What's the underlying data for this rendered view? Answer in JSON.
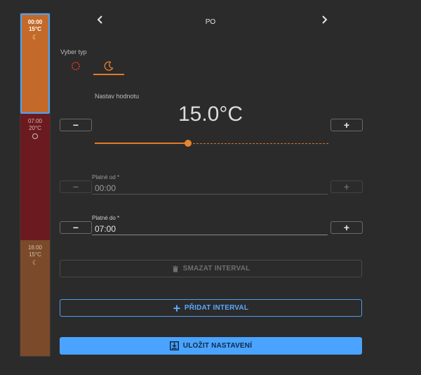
{
  "timeline": [
    {
      "time": "00:00",
      "temp": "15°C",
      "icon": "moon-icon",
      "color": "#c36a2a",
      "selected": true
    },
    {
      "time": "07:00",
      "temp": "20°C",
      "icon": "sun-icon",
      "color": "#6b1b1f",
      "selected": false
    },
    {
      "time": "16:00",
      "temp": "15°C",
      "icon": "moon-icon",
      "color": "#7a4a2a",
      "selected": false
    }
  ],
  "header": {
    "day": "PO",
    "prev_icon": "chevron-left-icon",
    "next_icon": "chevron-right-icon"
  },
  "type_selector": {
    "label": "Vyber typ",
    "options": [
      "sun-icon",
      "moon-icon"
    ],
    "selected": "moon-icon"
  },
  "setpoint": {
    "label": "Nastav hodnotu",
    "value": "15.0°C",
    "minus_label": "−",
    "plus_label": "+",
    "slider_level": 0.4
  },
  "valid_from": {
    "label": "Platné od *",
    "value": "00:00",
    "minus_label": "−",
    "plus_label": "+",
    "disabled": true
  },
  "valid_to": {
    "label": "Platné do *",
    "value": "07:00",
    "minus_label": "−",
    "plus_label": "+",
    "disabled": false
  },
  "actions": {
    "delete_label": "SMAZAT INTERVAL",
    "add_label": "PŘIDAT INTERVAL",
    "save_label": "ULOŽIT NASTAVENÍ"
  },
  "colors": {
    "accent": "#e07a2b",
    "primary": "#4aa3ff",
    "background": "#2b2b2b"
  }
}
